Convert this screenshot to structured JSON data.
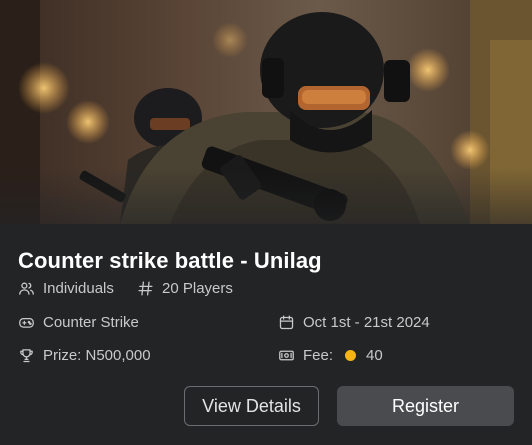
{
  "event": {
    "title": "Counter strike battle - Unilag",
    "mode": "Individuals",
    "players": "20 Players",
    "game": "Counter Strike",
    "dates": "Oct 1st - 21st 2024",
    "prize": "Prize:  N500,000",
    "fee_label": "Fee:",
    "fee_value": "40"
  },
  "actions": {
    "view_details": "View Details",
    "register": "Register"
  },
  "icons": {
    "mode": "users-icon",
    "players": "hash-icon",
    "game": "gamepad-icon",
    "dates": "calendar-icon",
    "prize": "trophy-icon",
    "fee": "ticket-icon",
    "coin": "coin-icon"
  },
  "colors": {
    "card_background": "#232426",
    "register_button": "#4a4b4f",
    "coin": "#f5b516"
  }
}
